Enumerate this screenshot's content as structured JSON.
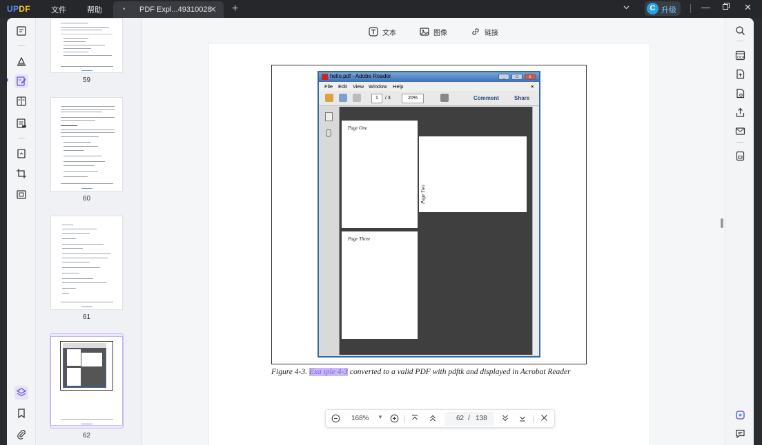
{
  "app": {
    "logo_left": "UP",
    "logo_right": "DF",
    "menus": [
      "文件",
      "帮助"
    ],
    "tab_title": "PDF Expl...49310028",
    "upgrade_icon": "C",
    "upgrade_label": "升级"
  },
  "edit_toolbar": {
    "text_label": "文本",
    "image_label": "图像",
    "link_label": "链接"
  },
  "thumbnails": [
    {
      "page": "59"
    },
    {
      "page": "60"
    },
    {
      "page": "61"
    },
    {
      "page": "62",
      "selected": true
    }
  ],
  "figure": {
    "window_title": "hello.pdf - Adobe Reader",
    "window_close": "×",
    "menu": [
      "File",
      "Edit",
      "View",
      "Window",
      "Help"
    ],
    "page_field": "1",
    "page_total": "/ 3",
    "zoom_field": "20%",
    "comment_label": "Comment",
    "share_label": "Share",
    "pages": [
      "Page One",
      "Page Two",
      "Page Three"
    ],
    "caption_prefix": "Figure 4-3.",
    "caption_highlight": "Exa  ıple 4-3",
    "caption_suffix": "converted to a valid PDF with pdftk and displayed in Acrobat Reader"
  },
  "navbar": {
    "zoom": "168%",
    "current_page": "62",
    "page_separator": "/",
    "total_pages": "138"
  },
  "colors": {
    "accent": "#7a5cf0",
    "highlight": "#c9b8f7",
    "titlebar": "#26272b"
  }
}
